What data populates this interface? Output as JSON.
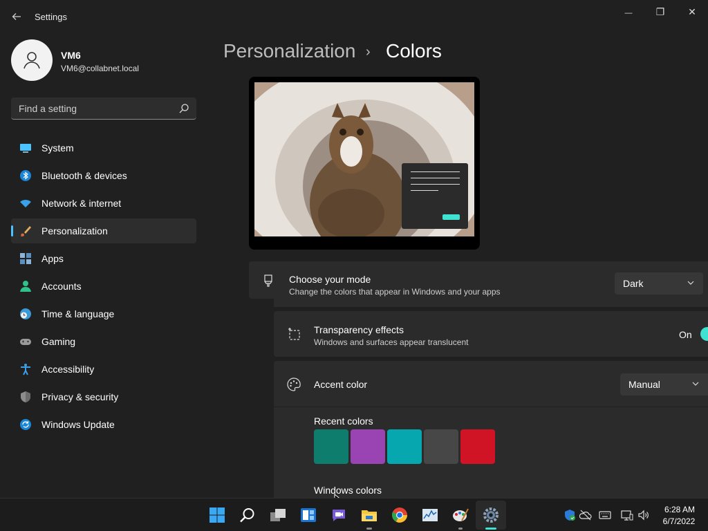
{
  "window": {
    "title": "Settings",
    "controls": {
      "minimize": "—",
      "maximize": "❐",
      "close": "✕"
    }
  },
  "user": {
    "name": "VM6",
    "email": "VM6@collabnet.local"
  },
  "search": {
    "placeholder": "Find a setting"
  },
  "sidebar": {
    "items": [
      {
        "label": "System",
        "icon": "system-icon"
      },
      {
        "label": "Bluetooth & devices",
        "icon": "bluetooth-icon"
      },
      {
        "label": "Network & internet",
        "icon": "wifi-icon"
      },
      {
        "label": "Personalization",
        "icon": "brush-icon",
        "active": true
      },
      {
        "label": "Apps",
        "icon": "apps-icon"
      },
      {
        "label": "Accounts",
        "icon": "accounts-icon"
      },
      {
        "label": "Time & language",
        "icon": "clock-globe-icon"
      },
      {
        "label": "Gaming",
        "icon": "gamepad-icon"
      },
      {
        "label": "Accessibility",
        "icon": "accessibility-icon"
      },
      {
        "label": "Privacy & security",
        "icon": "shield-icon"
      },
      {
        "label": "Windows Update",
        "icon": "update-icon"
      }
    ]
  },
  "breadcrumb": {
    "parent": "Personalization",
    "separator": "›",
    "current": "Colors"
  },
  "settings": {
    "mode": {
      "title": "Choose your mode",
      "subtitle": "Change the colors that appear in Windows and your apps",
      "value": "Dark"
    },
    "transparency": {
      "title": "Transparency effects",
      "subtitle": "Windows and surfaces appear translucent",
      "state_label": "On"
    },
    "accent": {
      "title": "Accent color",
      "value": "Manual"
    },
    "recent_colors": {
      "label": "Recent colors",
      "colors": [
        "#0f7d6e",
        "#9a44b4",
        "#07a7b0",
        "#474747",
        "#d01426"
      ]
    },
    "windows_colors": {
      "label": "Windows colors"
    }
  },
  "colors": {
    "accent": "#4cc2ff",
    "toggle_on": "#3fe2d0"
  },
  "taskbar": {
    "apps": [
      "start-icon",
      "search-icon",
      "task-view-icon",
      "widgets-icon",
      "teams-chat-icon",
      "file-explorer-icon",
      "chrome-icon",
      "resource-monitor-icon",
      "paint-icon",
      "settings-icon"
    ],
    "clock": {
      "time": "6:28 AM",
      "date": "6/7/2022"
    }
  }
}
